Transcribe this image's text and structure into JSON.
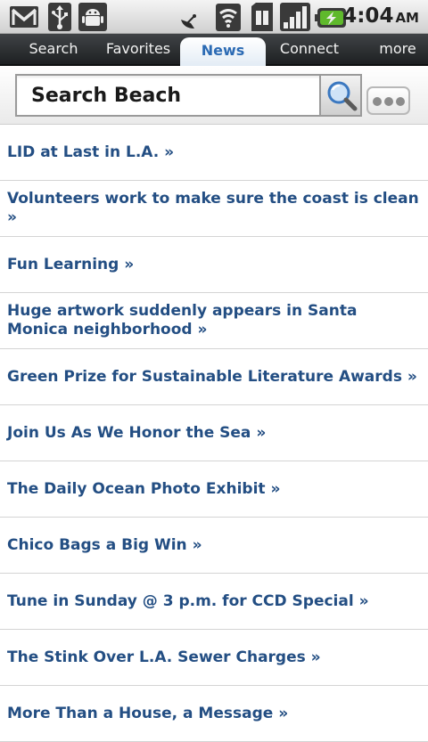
{
  "status_bar": {
    "icons": [
      "gmail-icon",
      "usb-icon",
      "android-debug-icon",
      "satellite-icon",
      "wifi-icon",
      "sim-icon",
      "signal-icon",
      "battery-charging-icon"
    ],
    "time": "4:04",
    "ampm": "AM"
  },
  "tabs": [
    {
      "label": "Search",
      "active": false
    },
    {
      "label": "Favorites",
      "active": false
    },
    {
      "label": "News",
      "active": true
    },
    {
      "label": "Connect",
      "active": false
    },
    {
      "label": "more",
      "active": false
    }
  ],
  "search": {
    "value": "Search Beach",
    "button_icon": "magnifier-icon",
    "more_icon": "ellipsis-icon"
  },
  "news": {
    "items": [
      "LID at Last in L.A. »",
      "Volunteers work to make sure the coast is clean »",
      "Fun Learning »",
      "Huge artwork suddenly appears in Santa Monica neighborhood »",
      "Green Prize for Sustainable Literature Awards »",
      "Join Us As We Honor the Sea »",
      "The Daily Ocean Photo Exhibit »",
      "Chico Bags a Big Win »",
      "Tune in Sunday @ 3 p.m. for CCD Special »",
      "The Stink Over L.A. Sewer Charges »",
      "More Than a House, a Message »"
    ]
  },
  "colors": {
    "link": "#234e83",
    "active_tab_text": "#2c6bb4",
    "tabbar": "#2a2c2e"
  }
}
